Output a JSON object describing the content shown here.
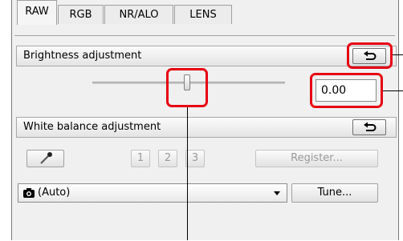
{
  "tabs": [
    {
      "label": "RAW",
      "active": true
    },
    {
      "label": "RGB",
      "active": false
    },
    {
      "label": "NR/ALO",
      "active": false
    },
    {
      "label": "LENS",
      "active": false
    }
  ],
  "brightness": {
    "label": "Brightness adjustment",
    "value": "0.00",
    "slider_fraction": 0.5
  },
  "white_balance": {
    "label": "White balance adjustment",
    "presets": [
      "1",
      "2",
      "3"
    ],
    "register_label": "Register...",
    "dropdown_value": "(Auto)",
    "tune_label": "Tune..."
  },
  "colors": {
    "highlight": "#e60012",
    "panel": "#f0f0f0"
  },
  "icons": {
    "reset": "reset-arrow-icon",
    "eyedropper": "eyedropper-icon",
    "camera": "camera-icon"
  }
}
